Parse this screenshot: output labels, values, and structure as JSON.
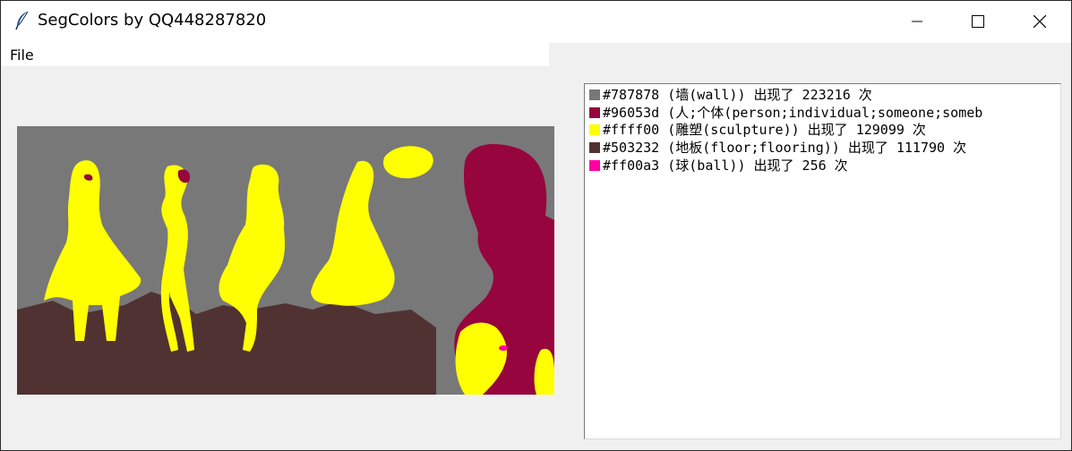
{
  "window": {
    "title": "SegColors by QQ448287820",
    "controls": {
      "minimize": "minimize",
      "maximize": "maximize",
      "close": "close"
    }
  },
  "menu": {
    "file_label": "File"
  },
  "legend": {
    "items": [
      {
        "color": "#787878",
        "text": "#787878 (墙(wall)) 出现了 223216 次"
      },
      {
        "color": "#96053d",
        "text": "#96053d (人;个体(person;individual;someone;someb"
      },
      {
        "color": "#ffff00",
        "text": "#ffff00 (雕塑(sculpture)) 出现了 129099 次"
      },
      {
        "color": "#503232",
        "text": "#503232 (地板(floor;flooring)) 出现了 111790 次"
      },
      {
        "color": "#ff00a3",
        "text": "#ff00a3 (球(ball)) 出现了 256 次"
      }
    ]
  },
  "segmentation": {
    "colors": {
      "wall": "#787878",
      "person": "#96053d",
      "sculpture": "#ffff00",
      "floor": "#503232",
      "ball": "#ff00a3"
    }
  }
}
